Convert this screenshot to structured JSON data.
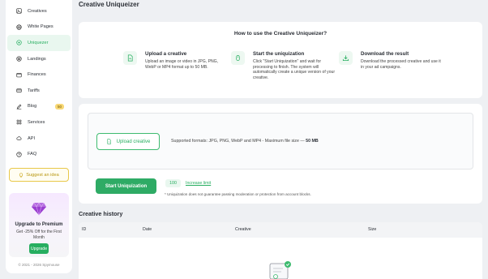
{
  "sidebar": {
    "items": [
      {
        "label": "Creatives",
        "icon": "image-icon",
        "active": false
      },
      {
        "label": "White Pages",
        "icon": "globe-icon",
        "active": false
      },
      {
        "label": "Uniquezer",
        "icon": "sparkle-icon",
        "active": true
      },
      {
        "label": "Landings",
        "icon": "target-icon",
        "active": false
      },
      {
        "label": "Finances",
        "icon": "wallet-icon",
        "active": false
      },
      {
        "label": "Tariffs",
        "icon": "card-icon",
        "active": false
      },
      {
        "label": "Blog",
        "icon": "pencil-icon",
        "active": false,
        "badge": "50"
      },
      {
        "label": "Services",
        "icon": "grid-icon",
        "active": false
      },
      {
        "label": "API",
        "icon": "cloud-icon",
        "active": false
      },
      {
        "label": "FAQ",
        "icon": "help-icon",
        "active": false
      }
    ],
    "suggest_label": "Suggest an idea",
    "promo": {
      "title": "Upgrade to Premium",
      "text": "Get -25% Off for the First Month",
      "button": "Upgrade"
    },
    "copyright": "© 2021 - 2026 Spymouse"
  },
  "page": {
    "title": "Creative Uniqueizer"
  },
  "howto": {
    "title": "How to use the Creative Uniqueizer?",
    "steps": [
      {
        "title": "Upload a creative",
        "text": "Upload an image or video in JPG, PNG, WebP or MP4 format up to 50 MB."
      },
      {
        "title": "Start the uniquization",
        "text": "Click \"Start Uniquization\" and wait for processing to finish. The system will automatically create a unique version of your creative."
      },
      {
        "title": "Download the result",
        "text": "Download the processed creative and use it in your ad campaigns."
      }
    ]
  },
  "upload": {
    "button": "Upload creative",
    "formats_prefix": "Supported formats: JPG, PNG, WebP and MP4 - Maximum file size — ",
    "formats_size": "50 MB",
    "start_button": "Start Uniquization",
    "counter": "100",
    "increase_link": "Increase limit",
    "disclaimer": "* Uniquization does not guarantee passing moderation or protection from account blocks."
  },
  "history": {
    "title": "Creative history",
    "columns": [
      "ID",
      "Date",
      "Creative",
      "Size"
    ]
  },
  "colors": {
    "accent": "#27ae60",
    "premium": "#a64bd6",
    "suggest": "#e8c84a"
  }
}
